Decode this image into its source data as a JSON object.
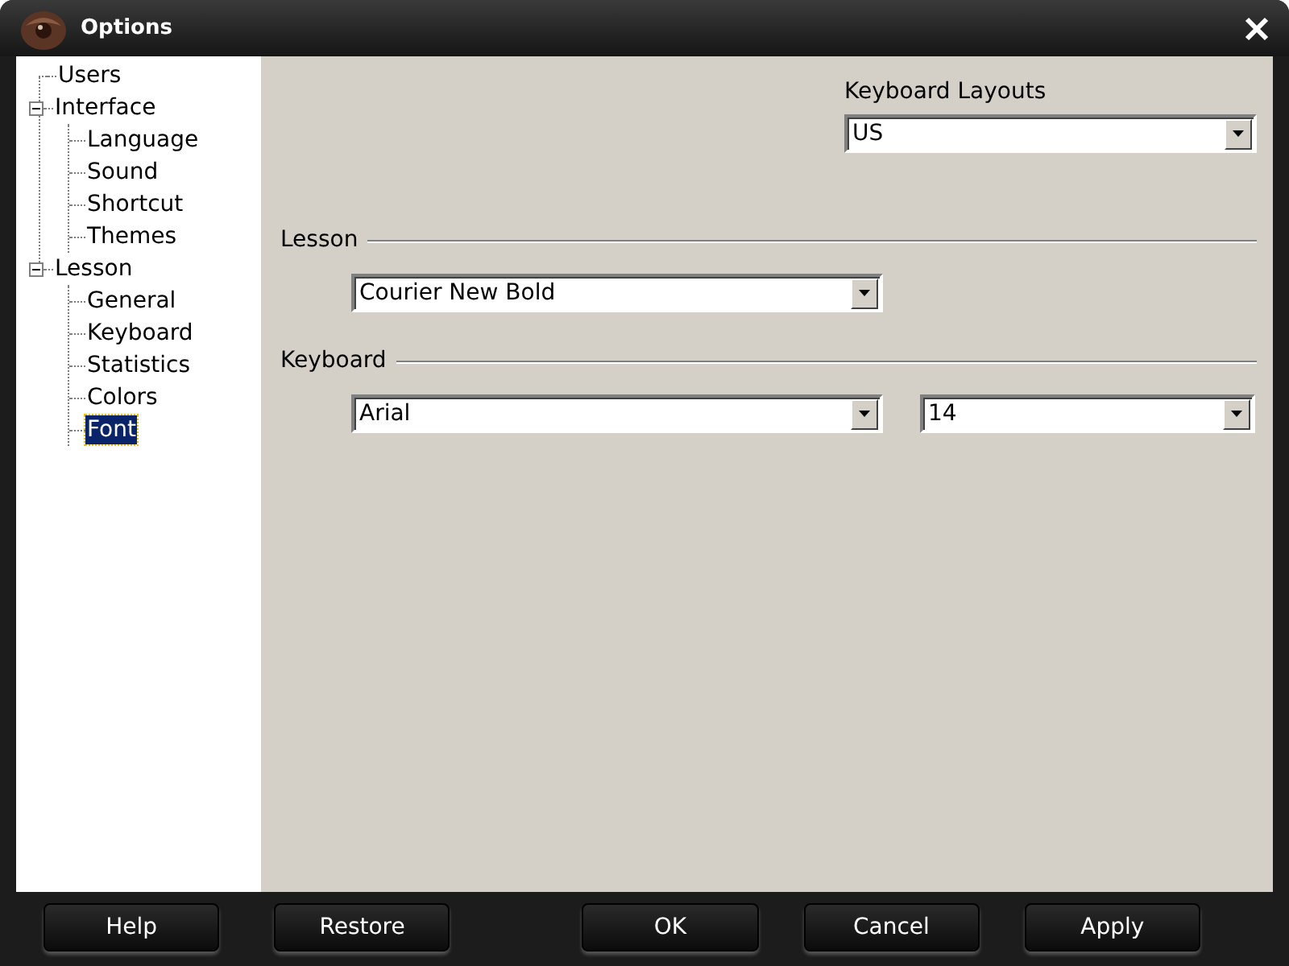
{
  "window": {
    "title": "Options"
  },
  "tree": [
    {
      "label": "Users",
      "selected": false
    },
    {
      "label": "Interface",
      "expanded": true,
      "selected": false,
      "children": [
        {
          "label": "Language",
          "selected": false
        },
        {
          "label": "Sound",
          "selected": false
        },
        {
          "label": "Shortcut",
          "selected": false
        },
        {
          "label": "Themes",
          "selected": false
        }
      ]
    },
    {
      "label": "Lesson",
      "expanded": true,
      "selected": false,
      "children": [
        {
          "label": "General",
          "selected": false
        },
        {
          "label": "Keyboard",
          "selected": false
        },
        {
          "label": "Statistics",
          "selected": false
        },
        {
          "label": "Colors",
          "selected": false
        },
        {
          "label": "Font",
          "selected": true
        }
      ]
    }
  ],
  "keyboard_layouts": {
    "label": "Keyboard Layouts",
    "value": "US"
  },
  "sections": [
    {
      "title": "Lesson",
      "fields": [
        {
          "value": "Courier New Bold"
        }
      ]
    },
    {
      "title": "Keyboard",
      "fields": [
        {
          "value": "Arial"
        },
        {
          "value": "14"
        }
      ]
    }
  ],
  "buttons": [
    "Help",
    "Restore",
    "OK",
    "Cancel",
    "Apply"
  ]
}
